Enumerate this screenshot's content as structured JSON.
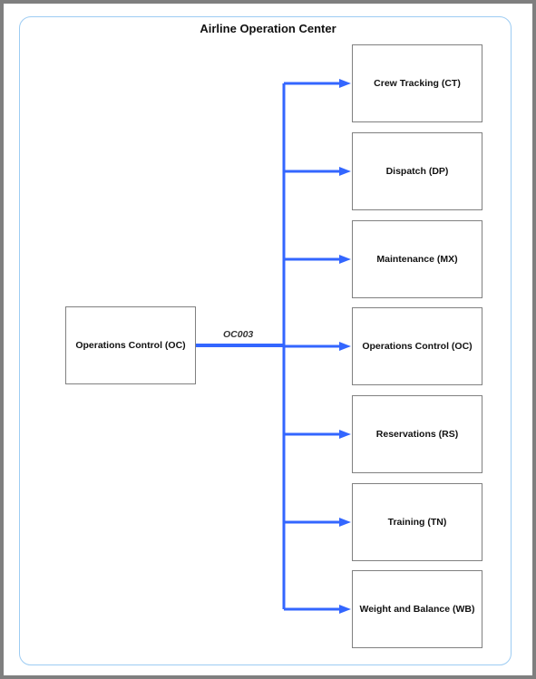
{
  "diagram": {
    "title": "Airline Operation Center",
    "source": {
      "id": "OC",
      "label": "Operations Control (OC)"
    },
    "edge_label": "OC003",
    "targets": [
      {
        "id": "CT",
        "label": "Crew Tracking (CT)"
      },
      {
        "id": "DP",
        "label": "Dispatch (DP)"
      },
      {
        "id": "MX",
        "label": "Maintenance (MX)"
      },
      {
        "id": "OC",
        "label": "Operations Control (OC)"
      },
      {
        "id": "RS",
        "label": "Reservations (RS)"
      },
      {
        "id": "TN",
        "label": "Training (TN)"
      },
      {
        "id": "WB",
        "label": "Weight and Balance (WB)"
      }
    ],
    "colors": {
      "connector": "#3366ff",
      "container_border": "#9dccf3",
      "node_border": "#808080",
      "frame": "#7f7f7f"
    }
  }
}
